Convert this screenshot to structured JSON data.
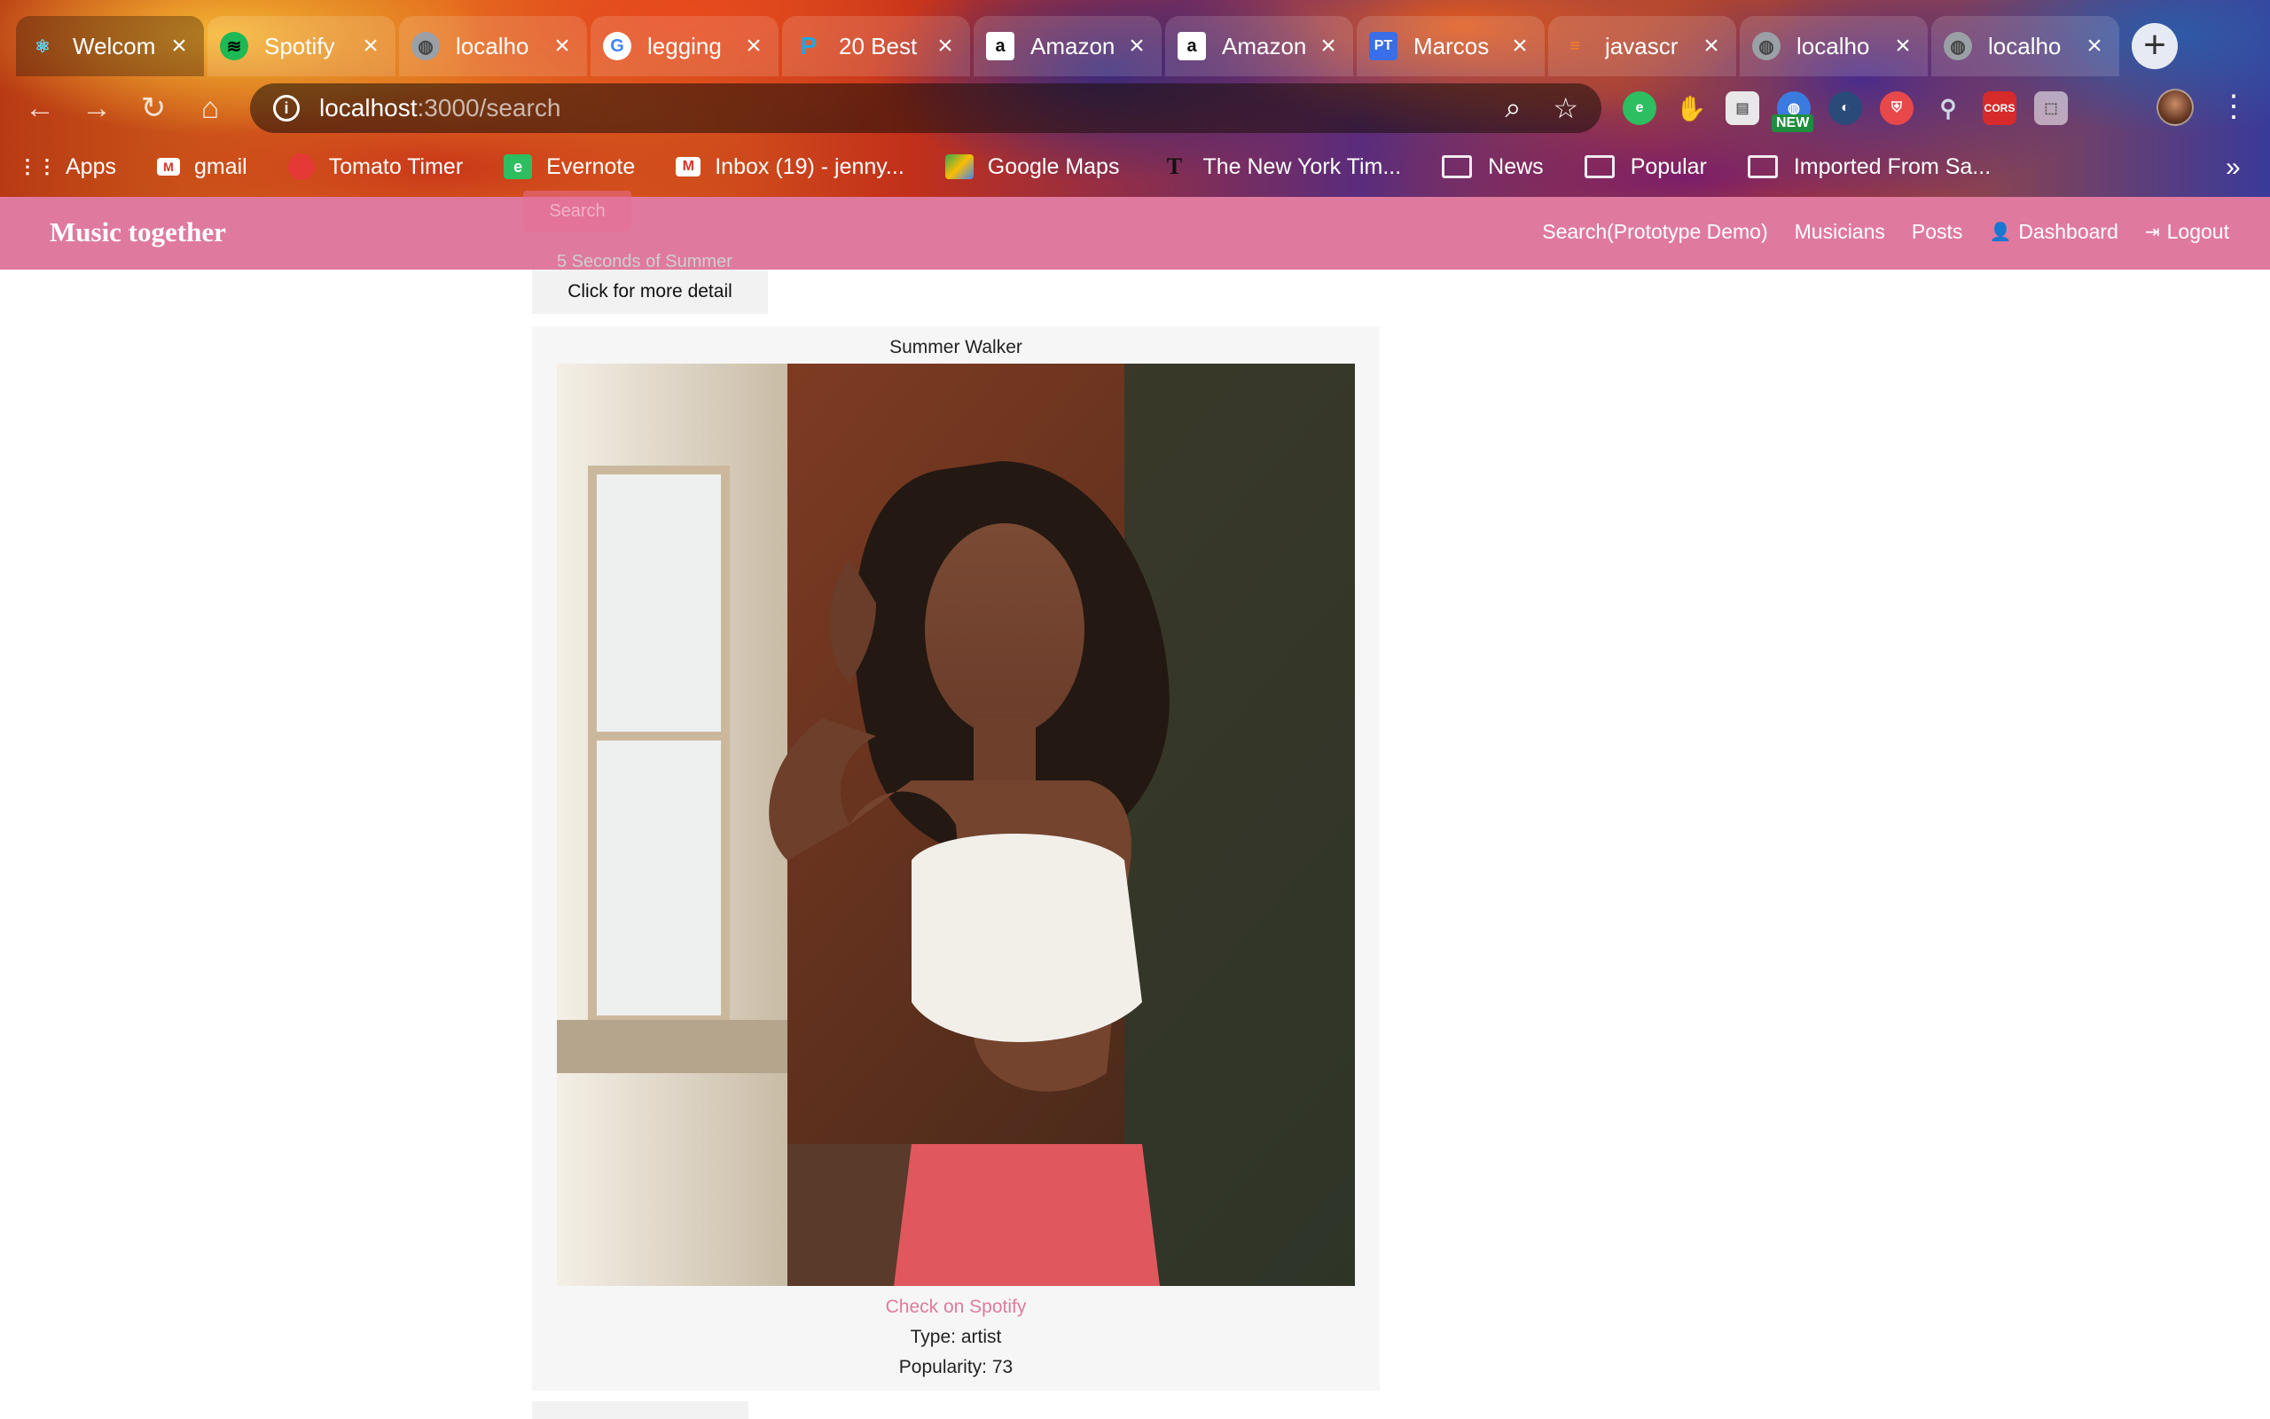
{
  "browser": {
    "tabs": [
      {
        "title": "Welcom",
        "icon": "react-icon",
        "color": "#61dafb",
        "active": true
      },
      {
        "title": "Spotify",
        "icon": "spotify-icon",
        "color": "#1db954"
      },
      {
        "title": "localho",
        "icon": "globe-icon",
        "color": "#9aa0a6"
      },
      {
        "title": "legging",
        "icon": "google-icon",
        "color": "#4285f4"
      },
      {
        "title": "20 Best",
        "icon": "p-icon",
        "color": "#1ea7e0"
      },
      {
        "title": "Amazon",
        "icon": "amazon-icon",
        "color": "#ffffff"
      },
      {
        "title": "Amazon",
        "icon": "amazon-icon",
        "color": "#ffffff"
      },
      {
        "title": "Marcos",
        "icon": "pt-icon",
        "color": "#3a6ee8"
      },
      {
        "title": "javascr",
        "icon": "stackoverflow-icon",
        "color": "#f48024"
      },
      {
        "title": "localho",
        "icon": "globe-icon",
        "color": "#9aa0a6"
      },
      {
        "title": "localho",
        "icon": "globe-icon",
        "color": "#9aa0a6"
      }
    ],
    "url_host": "localhost",
    "url_path": ":3000/search",
    "extension_badge": "NEW",
    "extension_cors": "CORS",
    "bookmarks": [
      {
        "label": "Apps",
        "icon": "apps-icon"
      },
      {
        "label": "gmail",
        "icon": "mail-icon"
      },
      {
        "label": "Tomato Timer",
        "icon": "tomato-icon"
      },
      {
        "label": "Evernote",
        "icon": "evernote-icon"
      },
      {
        "label": "Inbox (19) - jenny...",
        "icon": "gmail-icon"
      },
      {
        "label": "Google Maps",
        "icon": "maps-icon"
      },
      {
        "label": "The New York Tim...",
        "icon": "nyt-icon"
      },
      {
        "label": "News",
        "icon": "folder-icon"
      },
      {
        "label": "Popular",
        "icon": "folder-icon"
      },
      {
        "label": "Imported From Sa...",
        "icon": "folder-icon"
      }
    ]
  },
  "app": {
    "brand": "Music together",
    "accent": "#df7a9e",
    "nav": {
      "search": "Search(Prototype Demo)",
      "musicians": "Musicians",
      "posts": "Posts",
      "dashboard": "Dashboard",
      "logout": "Logout"
    },
    "ghost_search_label": "Search",
    "ghost_previous_result": "5 Seconds of Summer"
  },
  "results": {
    "detail_button": "Click for more detail",
    "artist": {
      "name": "Summer Walker",
      "spotify_link": "Check on Spotify",
      "type": "Type: artist",
      "popularity": "Popularity: 73"
    }
  }
}
